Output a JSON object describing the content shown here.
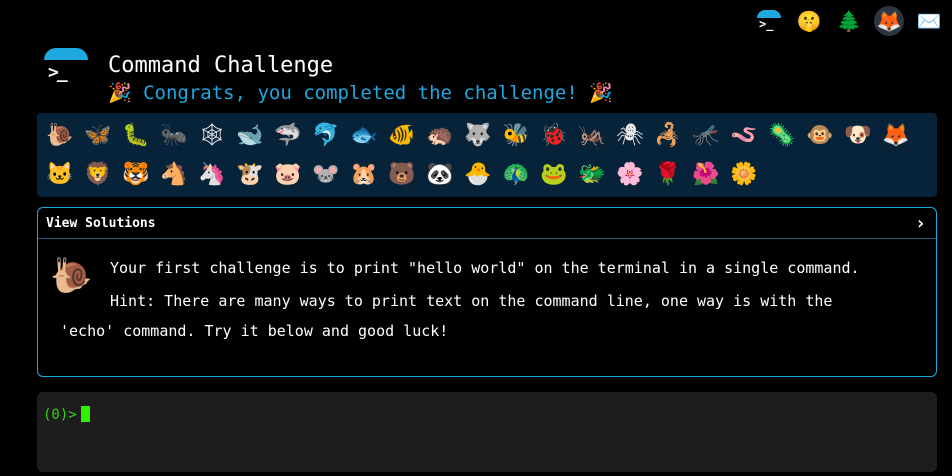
{
  "top_icons": [
    "terminal-logo",
    "shushing-face",
    "tree",
    "gitlab",
    "envelope"
  ],
  "header": {
    "title": "Command Challenge",
    "subtitle": "🎉 Congrats, you completed the challenge! 🎉"
  },
  "animals": [
    "🐌",
    "🦋",
    "🐛",
    "🐜",
    "🕸",
    "🐋",
    "🦈",
    "🐬",
    "🐟",
    "🐠",
    "🦔",
    "🐺",
    "🐝",
    "🐞",
    "🦗",
    "🕷",
    "🦂",
    "🦟",
    "🪱",
    "🦠",
    "🐵",
    "🐶",
    "🦊",
    "🐱",
    "🦁",
    "🐯",
    "🐴",
    "🦄",
    "🐮",
    "🐷",
    "🐭",
    "🐹",
    "🐻",
    "🐼",
    "🐣",
    "🦚",
    "🐸",
    "🐲",
    "🌸",
    "🌹",
    "🌺",
    "🌼"
  ],
  "panel": {
    "title": "View Solutions",
    "chevron": "›",
    "challenge": "Your first challenge is to print \"hello world\" on the terminal in a single command.",
    "hint_a": "Hint: There are many ways to print text on the command line, one way is with the",
    "hint_b": "'echo' command. Try it below and good luck!"
  },
  "terminal": {
    "prompt": "(0)>"
  }
}
